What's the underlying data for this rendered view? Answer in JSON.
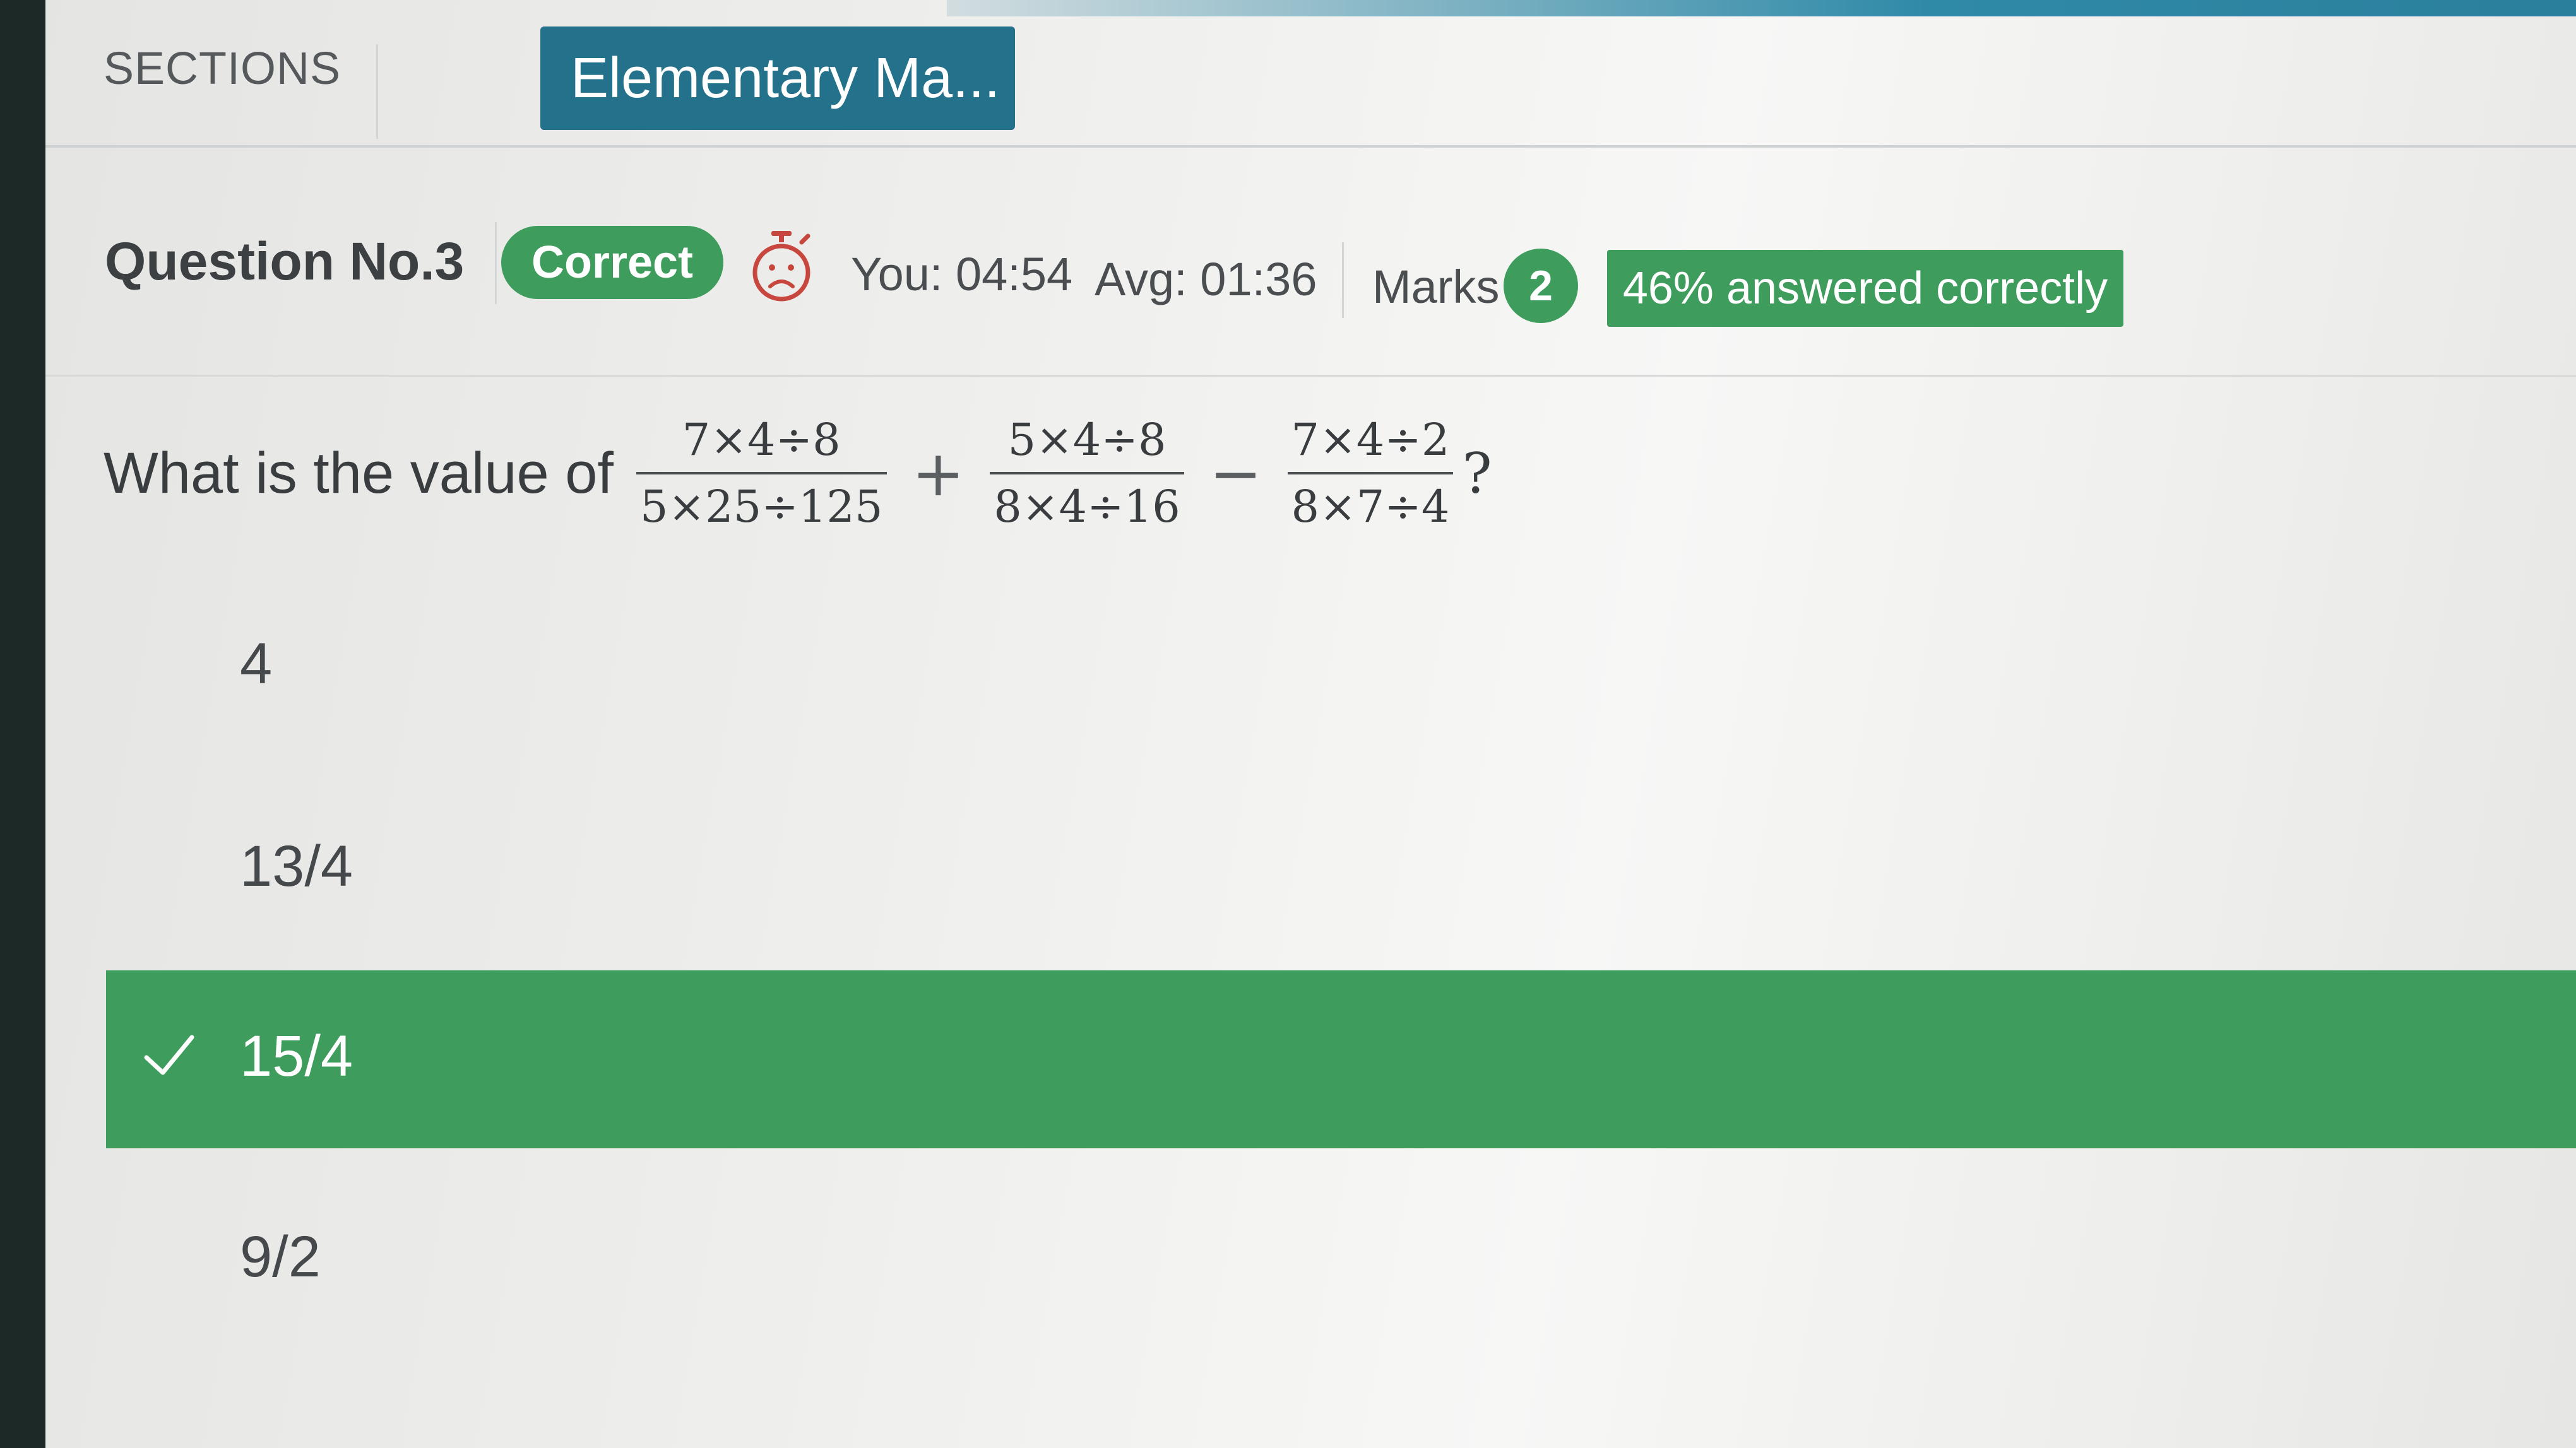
{
  "header": {
    "sections_label": "SECTIONS",
    "section_tab": "Elementary Ma..."
  },
  "meta": {
    "question_label": "Question No.3",
    "status_pill": "Correct",
    "timer_icon": "stopwatch-sad-face-icon",
    "time_you": "You: 04:54",
    "time_avg": "Avg: 01:36",
    "marks_label": "Marks",
    "marks_value": "2",
    "answered_pct": 46,
    "answered_text": "46% answered correctly"
  },
  "question": {
    "prefix": "What is the value of",
    "term1": {
      "num": "7×4÷8",
      "den": "5×25÷125"
    },
    "op1": "+",
    "term2": {
      "num": "5×4÷8",
      "den": "8×4÷16"
    },
    "op2": "−",
    "term3": {
      "num": "7×4÷2",
      "den": "8×7÷4"
    },
    "suffix": "?"
  },
  "options": [
    {
      "label": "4",
      "selected": false
    },
    {
      "label": "13/4",
      "selected": false
    },
    {
      "label": "15/4",
      "selected": true,
      "icon": "check-icon"
    },
    {
      "label": "9/2",
      "selected": false
    }
  ],
  "colors": {
    "accent_teal": "#23718a",
    "success_green": "#3e9d5c"
  }
}
